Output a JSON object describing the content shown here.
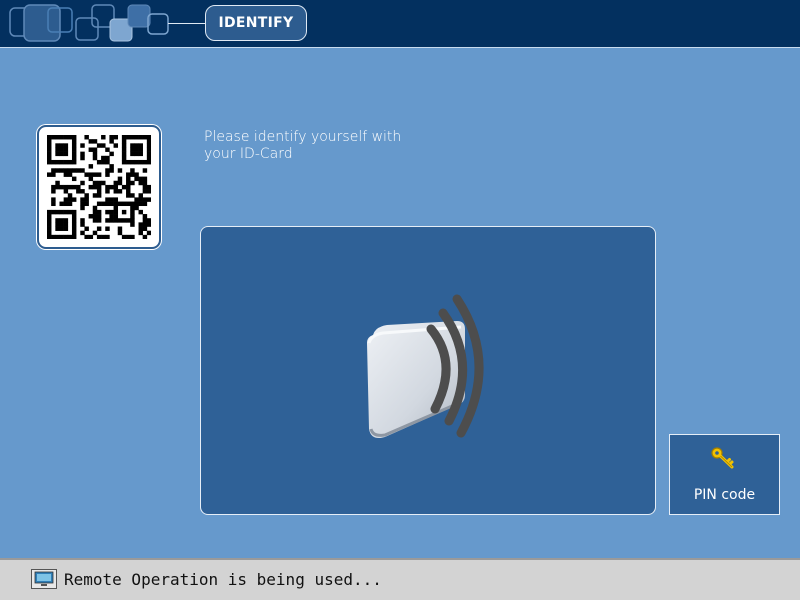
{
  "header": {
    "title": "IDENTIFY",
    "logo_icon": "overlapping-squares-logo"
  },
  "qr_code": {
    "icon": "qr-code-icon"
  },
  "instruction": {
    "line1": "Please identify yourself with",
    "line2": "your ID-Card"
  },
  "card_reader": {
    "icon": "contactless-card-icon"
  },
  "pin_button": {
    "label": "PIN code",
    "icon": "key-icon"
  },
  "status_bar": {
    "text": "Remote Operation is being used...",
    "icon": "monitor-icon"
  },
  "colors": {
    "background": "#6699cc",
    "header": "#03305f",
    "panel": "#2f6197",
    "key": "#f2c200",
    "status_bar": "#d3d3d3"
  }
}
